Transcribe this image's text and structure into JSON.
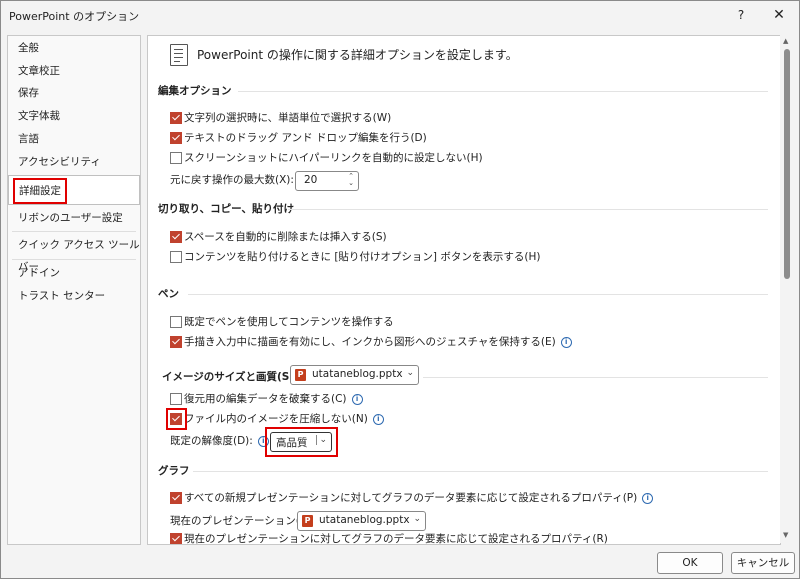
{
  "window": {
    "title": "PowerPoint のオプション",
    "help": "?",
    "close": "✕"
  },
  "sidebar": {
    "items": [
      {
        "label": "全般"
      },
      {
        "label": "文章校正"
      },
      {
        "label": "保存"
      },
      {
        "label": "文字体裁"
      },
      {
        "label": "言語"
      },
      {
        "label": "アクセシビリティ"
      },
      {
        "label": "詳細設定",
        "selected": true
      },
      {
        "label": "リボンのユーザー設定"
      },
      {
        "label": "クイック アクセス ツール バー"
      },
      {
        "label": "アドイン"
      },
      {
        "label": "トラスト センター"
      }
    ]
  },
  "header": {
    "text": "PowerPoint の操作に関する詳細オプションを設定します。"
  },
  "sections": {
    "edit": {
      "title": "編集オプション",
      "opt1": "文字列の選択時に、単語単位で選択する(W)",
      "opt2": "テキストのドラッグ アンド ドロップ編集を行う(D)",
      "opt3": "スクリーンショットにハイパーリンクを自動的に設定しない(H)",
      "undo_label": "元に戻す操作の最大数(X):",
      "undo_value": "20"
    },
    "cut": {
      "title": "切り取り、コピー、貼り付け",
      "opt1": "スペースを自動的に削除または挿入する(S)",
      "opt2": "コンテンツを貼り付けるときに [貼り付けオプション] ボタンを表示する(H)"
    },
    "pen": {
      "title": "ペン",
      "opt1": "既定でペンを使用してコンテンツを操作する",
      "opt2": "手描き入力中に描画を有効にし、インクから図形へのジェスチャを保持する(E)"
    },
    "image": {
      "title": "イメージのサイズと画質(S)",
      "file": "utataneblog.pptx",
      "opt1": "復元用の編集データを破棄する(C)",
      "opt2": "ファイル内のイメージを圧縮しない(N)",
      "res_label": "既定の解像度(D):",
      "res_value": "高品質"
    },
    "chart": {
      "title": "グラフ",
      "opt1": "すべての新規プレゼンテーションに対してグラフのデータ要素に応じて設定されるプロパティ(P)",
      "current_label": "現在のプレゼンテーション(C):",
      "file": "utataneblog.pptx",
      "opt2": "現在のプレゼンテーションに対してグラフのデータ要素に応じて設定されるプロパティ(R)"
    }
  },
  "buttons": {
    "ok": "OK",
    "cancel": "キャンセル"
  },
  "info_glyph": "i",
  "spin_arrows": "⌃⌄",
  "colors": {
    "checkbox_checked": "#c0422e",
    "highlight": "#e00000"
  }
}
